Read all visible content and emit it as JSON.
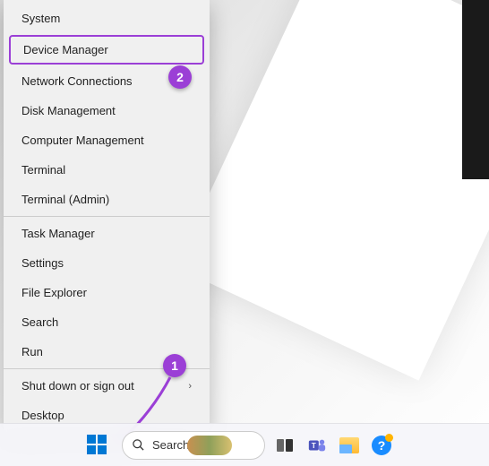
{
  "menu": {
    "groups": [
      [
        {
          "label": "System",
          "name": "menu-item-system"
        },
        {
          "label": "Device Manager",
          "name": "menu-item-device-manager",
          "highlighted": true
        },
        {
          "label": "Network Connections",
          "name": "menu-item-network-connections"
        },
        {
          "label": "Disk Management",
          "name": "menu-item-disk-management"
        },
        {
          "label": "Computer Management",
          "name": "menu-item-computer-management"
        },
        {
          "label": "Terminal",
          "name": "menu-item-terminal"
        },
        {
          "label": "Terminal (Admin)",
          "name": "menu-item-terminal-admin"
        }
      ],
      [
        {
          "label": "Task Manager",
          "name": "menu-item-task-manager"
        },
        {
          "label": "Settings",
          "name": "menu-item-settings"
        },
        {
          "label": "File Explorer",
          "name": "menu-item-file-explorer"
        },
        {
          "label": "Search",
          "name": "menu-item-search"
        },
        {
          "label": "Run",
          "name": "menu-item-run"
        }
      ],
      [
        {
          "label": "Shut down or sign out",
          "name": "menu-item-shutdown",
          "submenu": true
        },
        {
          "label": "Desktop",
          "name": "menu-item-desktop"
        }
      ]
    ]
  },
  "annotations": {
    "badge1": "1",
    "badge2": "2",
    "color": "#9b3fd6"
  },
  "taskbar": {
    "search_label": "Search"
  }
}
